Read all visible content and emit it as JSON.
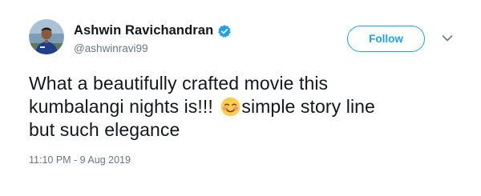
{
  "tweet": {
    "author": {
      "display_name": "Ashwin Ravichandran",
      "handle": "@ashwinravi99",
      "verified": true,
      "avatar_icon": "profile-photo"
    },
    "follow_label": "Follow",
    "menu_icon": "chevron-down-icon",
    "text": {
      "line1": "What a beautifully crafted movie this",
      "line2_before_emoji": "kumbalangi nights is!!! ",
      "emoji": "smiling-face-with-hearts-blush-icon",
      "line2_after_emoji": "simple story line",
      "line3": "but such elegance"
    },
    "timestamp": "11:10 PM - 9 Aug 2019"
  },
  "colors": {
    "accent": "#1da1f2",
    "text_primary": "#14171a",
    "text_secondary": "#657786"
  }
}
